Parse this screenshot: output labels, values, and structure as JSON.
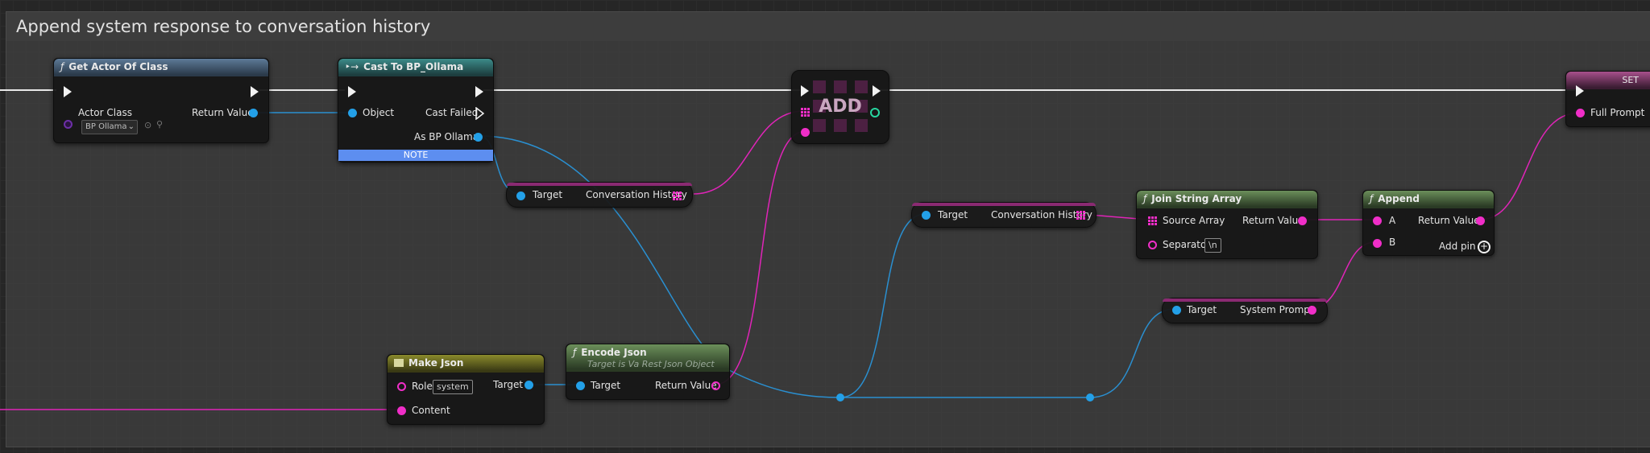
{
  "comment": {
    "title": "Append system response to conversation history"
  },
  "nodes": {
    "get_actor": {
      "title": "Get Actor Of Class",
      "pin_actor_class": "Actor Class",
      "pin_return": "Return Value",
      "class_value": "BP Ollama"
    },
    "cast": {
      "title": "Cast To BP_Ollama",
      "pin_object": "Object",
      "pin_cast_failed": "Cast Failed",
      "pin_as": "As BP Ollama",
      "note": "NOTE"
    },
    "var_history_1": {
      "target": "Target",
      "name": "Conversation History"
    },
    "add": {
      "label": "ADD"
    },
    "make_json": {
      "title": "Make Json",
      "pin_role": "Role",
      "role_value": "system",
      "pin_target": "Target",
      "pin_content": "Content"
    },
    "encode_json": {
      "title": "Encode Json",
      "subtitle": "Target is Va Rest Json Object",
      "pin_target": "Target",
      "pin_return": "Return Value"
    },
    "var_history_2": {
      "target": "Target",
      "name": "Conversation History"
    },
    "join": {
      "title": "Join String Array",
      "pin_source": "Source Array",
      "pin_return": "Return Value",
      "pin_separator": "Separator",
      "separator_value": "\\n"
    },
    "var_system_prompt": {
      "target": "Target",
      "name": "System Prompt"
    },
    "append": {
      "title": "Append",
      "pin_a": "A",
      "pin_b": "B",
      "pin_return": "Return Value",
      "add_pin": "Add pin"
    },
    "set": {
      "title": "SET",
      "pin_full_prompt": "Full Prompt"
    }
  },
  "colors": {
    "exec": "#f2f2f2",
    "object": "#23a0e8",
    "string": "#f02ec8",
    "class": "#6d2fa8"
  }
}
